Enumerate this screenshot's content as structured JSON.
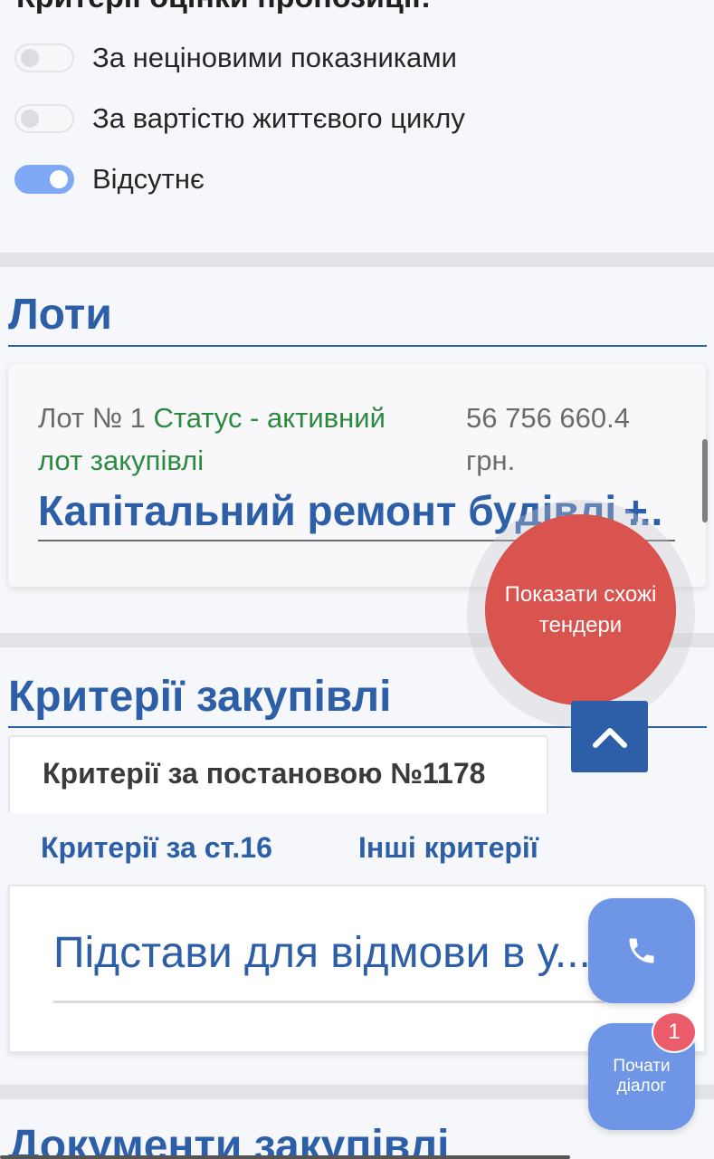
{
  "evaluation": {
    "heading": "Критерії оцінки пропозиції:",
    "options": [
      {
        "label": "За неціновими показниками",
        "checked": false
      },
      {
        "label": "За вартістю життєвого циклу",
        "checked": false
      },
      {
        "label": "Відсутнє",
        "checked": true
      }
    ]
  },
  "lots": {
    "title": "Лоти",
    "lot": {
      "number_label": "Лот № 1",
      "status_label": "Статус - активний лот закупівлі",
      "price_amount": "56 756 660.4",
      "price_currency": "грн.",
      "name": "Капітальний ремонт будівлі ...",
      "expand_label": "+"
    }
  },
  "criteria": {
    "title": "Критерії закупівлі",
    "tabs": [
      {
        "label": "Критерії за постановою №1178",
        "active": true
      },
      {
        "label": "Критерії за ст.16",
        "active": false
      },
      {
        "label": "Інші критерії",
        "active": false
      }
    ],
    "item": "Підстави для відмови в у..."
  },
  "documents": {
    "title": "Документи закупівлі"
  },
  "floating": {
    "similar_tenders": "Показати схожі тендери",
    "up_icon": "chevron-up-icon",
    "call_icon": "phone-icon",
    "chat_label": "Почати діалог",
    "chat_badge": "1"
  },
  "colors": {
    "accent": "#2d5ea8",
    "status_green": "#2b8a3e",
    "similar_red": "#d9534f",
    "fab_blue": "#6f96e6",
    "badge_pink": "#ea5b6b",
    "toggle_on": "#7fa9f4"
  }
}
